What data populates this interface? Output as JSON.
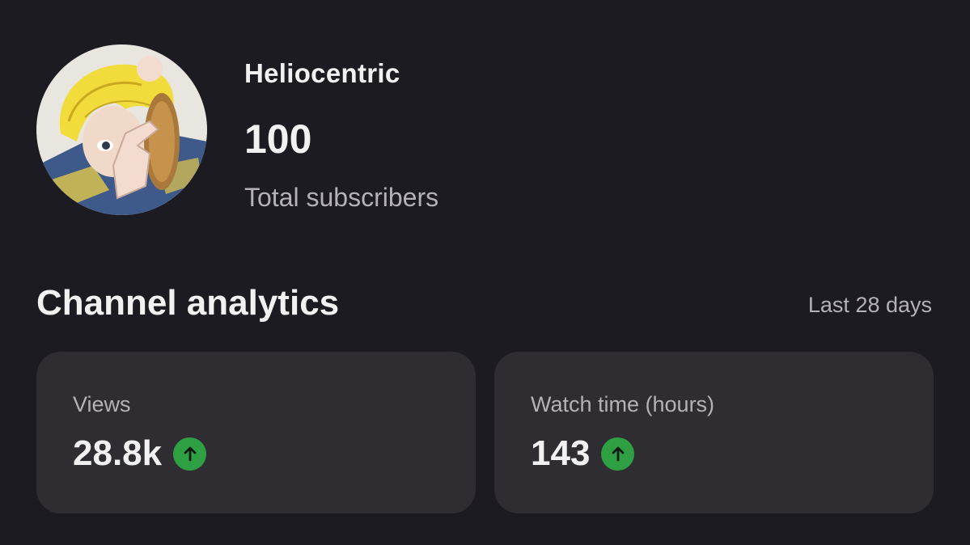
{
  "channel": {
    "name": "Heliocentric",
    "subscriber_count": "100",
    "subscriber_label": "Total subscribers",
    "avatar_icon": "avatar-illustration"
  },
  "analytics": {
    "title": "Channel analytics",
    "period": "Last 28 days",
    "cards": [
      {
        "label": "Views",
        "value": "28.8k",
        "trend": "up",
        "trend_icon": "arrow-up-icon"
      },
      {
        "label": "Watch time (hours)",
        "value": "143",
        "trend": "up",
        "trend_icon": "arrow-up-icon"
      }
    ]
  },
  "colors": {
    "background": "#1c1b21",
    "card": "#2f2d32",
    "trend_up": "#2ea043",
    "primary_text": "#f1f1f1",
    "secondary_text": "#b5b2b7"
  }
}
